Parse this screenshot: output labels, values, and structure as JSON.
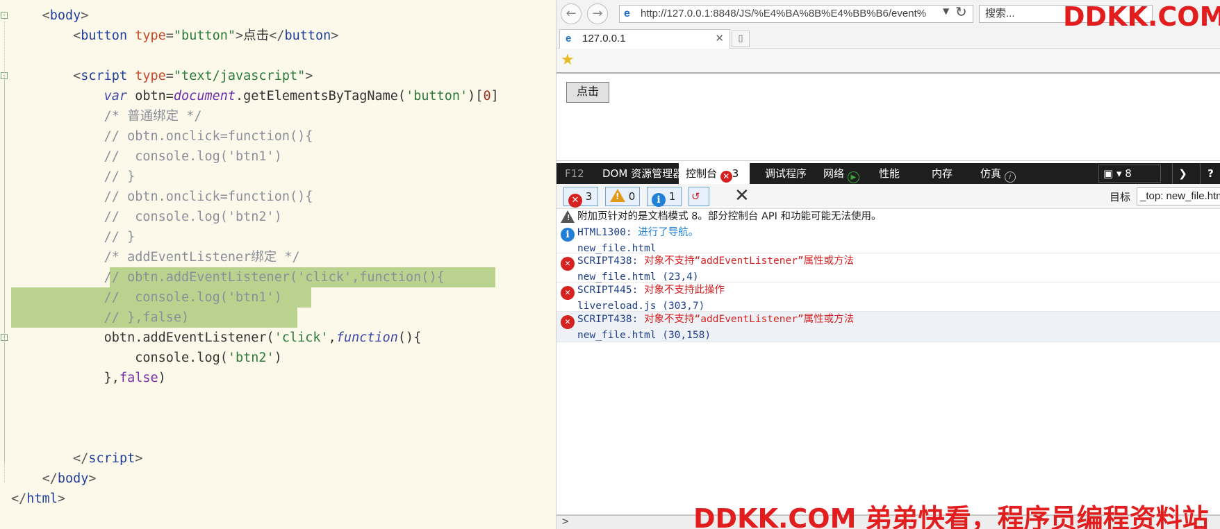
{
  "editor": {
    "lines": [
      [
        {
          "t": "    ",
          "c": "c-plain"
        },
        {
          "t": "<",
          "c": "c-punc"
        },
        {
          "t": "body",
          "c": "c-tag"
        },
        {
          "t": ">",
          "c": "c-punc"
        }
      ],
      [
        {
          "t": "        ",
          "c": "c-plain"
        },
        {
          "t": "<",
          "c": "c-punc"
        },
        {
          "t": "button",
          "c": "c-tag"
        },
        {
          "t": " ",
          "c": "c-plain"
        },
        {
          "t": "type",
          "c": "c-attr"
        },
        {
          "t": "=",
          "c": "c-punc"
        },
        {
          "t": "\"button\"",
          "c": "c-str"
        },
        {
          "t": ">",
          "c": "c-punc"
        },
        {
          "t": "点击",
          "c": "c-plain"
        },
        {
          "t": "</",
          "c": "c-punc"
        },
        {
          "t": "button",
          "c": "c-tag"
        },
        {
          "t": ">",
          "c": "c-punc"
        }
      ],
      [],
      [
        {
          "t": "        ",
          "c": "c-plain"
        },
        {
          "t": "<",
          "c": "c-punc"
        },
        {
          "t": "script",
          "c": "c-tag"
        },
        {
          "t": " ",
          "c": "c-plain"
        },
        {
          "t": "type",
          "c": "c-attr"
        },
        {
          "t": "=",
          "c": "c-punc"
        },
        {
          "t": "\"text/javascript\"",
          "c": "c-str"
        },
        {
          "t": ">",
          "c": "c-punc"
        }
      ],
      [
        {
          "t": "            ",
          "c": "c-plain"
        },
        {
          "t": "var",
          "c": "c-kw"
        },
        {
          "t": " obtn=",
          "c": "c-plain"
        },
        {
          "t": "document",
          "c": "c-obj"
        },
        {
          "t": ".getElementsByTagName(",
          "c": "c-plain"
        },
        {
          "t": "'button'",
          "c": "c-str"
        },
        {
          "t": ")[",
          "c": "c-plain"
        },
        {
          "t": "0",
          "c": "c-num"
        },
        {
          "t": "]",
          "c": "c-plain"
        }
      ],
      [
        {
          "t": "            ",
          "c": "c-plain"
        },
        {
          "t": "/* 普通绑定 */",
          "c": "c-cmt"
        }
      ],
      [
        {
          "t": "            ",
          "c": "c-plain"
        },
        {
          "t": "// obtn.onclick=function(){",
          "c": "c-cmt"
        }
      ],
      [
        {
          "t": "            ",
          "c": "c-plain"
        },
        {
          "t": "//  console.log('btn1')",
          "c": "c-cmt"
        }
      ],
      [
        {
          "t": "            ",
          "c": "c-plain"
        },
        {
          "t": "// }",
          "c": "c-cmt"
        }
      ],
      [
        {
          "t": "            ",
          "c": "c-plain"
        },
        {
          "t": "// obtn.onclick=function(){",
          "c": "c-cmt"
        }
      ],
      [
        {
          "t": "            ",
          "c": "c-plain"
        },
        {
          "t": "//  console.log('btn2')",
          "c": "c-cmt"
        }
      ],
      [
        {
          "t": "            ",
          "c": "c-plain"
        },
        {
          "t": "// }",
          "c": "c-cmt"
        }
      ],
      [
        {
          "t": "            ",
          "c": "c-plain"
        },
        {
          "t": "/* addEventListener绑定 */",
          "c": "c-cmt"
        }
      ],
      [
        {
          "t": "            ",
          "c": "c-plain"
        },
        {
          "t": "// obtn.addEventListener('click',function(){",
          "c": "c-cmt"
        }
      ],
      [
        {
          "t": "            ",
          "c": "c-plain"
        },
        {
          "t": "//  console.log('btn1')",
          "c": "c-cmt"
        }
      ],
      [
        {
          "t": "            ",
          "c": "c-plain"
        },
        {
          "t": "// },false)",
          "c": "c-cmt"
        }
      ],
      [
        {
          "t": "            ",
          "c": "c-plain"
        },
        {
          "t": "obtn.addEventListener(",
          "c": "c-plain"
        },
        {
          "t": "'click'",
          "c": "c-str"
        },
        {
          "t": ",",
          "c": "c-plain"
        },
        {
          "t": "function",
          "c": "c-kw"
        },
        {
          "t": "(){",
          "c": "c-plain"
        }
      ],
      [
        {
          "t": "                ",
          "c": "c-plain"
        },
        {
          "t": "console.log(",
          "c": "c-plain"
        },
        {
          "t": "'btn2'",
          "c": "c-str"
        },
        {
          "t": ")",
          "c": "c-plain"
        }
      ],
      [
        {
          "t": "            ",
          "c": "c-plain"
        },
        {
          "t": "},",
          "c": "c-plain"
        },
        {
          "t": "false",
          "c": "c-false"
        },
        {
          "t": ")",
          "c": "c-plain"
        }
      ],
      [],
      [],
      [],
      [
        {
          "t": "        ",
          "c": "c-plain"
        },
        {
          "t": "</",
          "c": "c-punc"
        },
        {
          "t": "script",
          "c": "c-tag"
        },
        {
          "t": ">",
          "c": "c-punc"
        }
      ],
      [
        {
          "t": "    ",
          "c": "c-plain"
        },
        {
          "t": "</",
          "c": "c-punc"
        },
        {
          "t": "body",
          "c": "c-tag"
        },
        {
          "t": ">",
          "c": "c-punc"
        }
      ],
      [
        {
          "t": "</",
          "c": "c-punc"
        },
        {
          "t": "html",
          "c": "c-tag"
        },
        {
          "t": ">",
          "c": "c-punc"
        }
      ]
    ],
    "selected_lines": [
      13,
      14,
      15
    ],
    "fold_markers": [
      0,
      3,
      16
    ]
  },
  "browser": {
    "back_icon": "back-arrow-icon",
    "forward_icon": "forward-arrow-icon",
    "url": "http://127.0.0.1:8848/JS/%E4%BA%8B%E4%BB%B6/event%",
    "search_placeholder": "搜索...",
    "tab_title": "127.0.0.1",
    "page_button_label": "点击"
  },
  "devtools": {
    "f12": "F12",
    "dom": "DOM 资源管理器",
    "console": "控制台",
    "console_errors": "3",
    "debugger": "调试程序",
    "network": "网络",
    "performance": "性能",
    "memory": "内存",
    "emulation": "仿真",
    "screens": "8",
    "help": "?"
  },
  "console": {
    "filters": {
      "errors": "3",
      "warnings": "0",
      "messages": "1"
    },
    "target_label": "目标",
    "target_value": "_top: new_file.htm",
    "messages": [
      {
        "type": "warning",
        "text": "附加页针对的是文档模式 8。部分控制台 API 和功能可能无法使用。",
        "source": ""
      },
      {
        "type": "info",
        "code": "HTML1300:",
        "text": " 进行了导航。",
        "source": "new_file.html"
      },
      {
        "type": "error",
        "code": "SCRIPT438:",
        "text": " 对象不支持“addEventListener”属性或方法",
        "source": "new_file.html (23,4)"
      },
      {
        "type": "error",
        "code": "SCRIPT445:",
        "text": " 对象不支持此操作",
        "source": "livereload.js (303,7)"
      },
      {
        "type": "error",
        "code": "SCRIPT438:",
        "text": " 对象不支持“addEventListener”属性或方法",
        "source": "new_file.html (30,158)"
      }
    ],
    "prompt": ">"
  },
  "watermark": {
    "top": "DDKK.COM",
    "bottom": "DDKK.COM 弟弟快看，程序员编程资料站"
  },
  "colors": {
    "editor_bg": "#fdf9ea",
    "selection": "#b9d38f",
    "error": "#d62121",
    "info": "#1f7fd6",
    "watermark": "#e21d1d"
  }
}
